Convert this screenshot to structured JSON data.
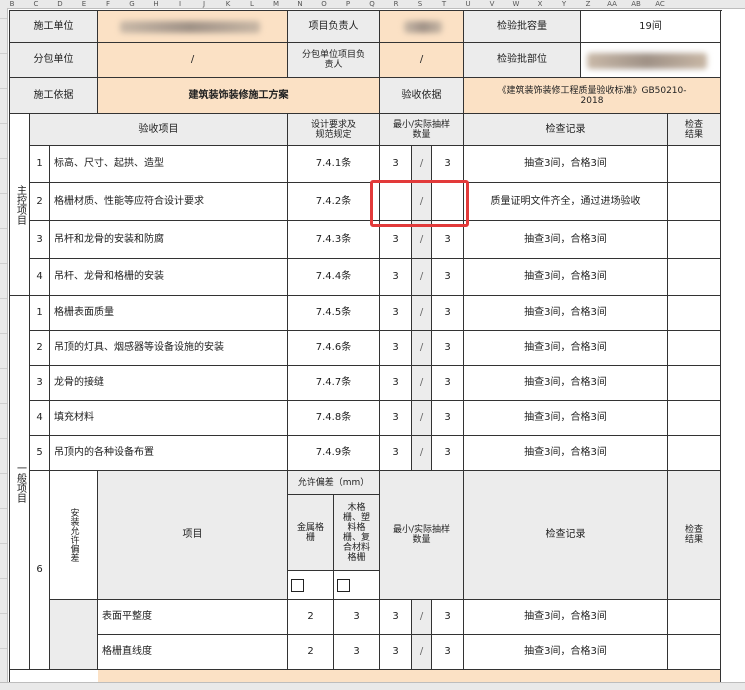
{
  "header": {
    "unit_label": "施工单位",
    "owner_label": "项目负责人",
    "capacity_label": "检验批容量",
    "capacity_value": "19间",
    "sub_unit_label": "分包单位",
    "sub_unit_value": "/",
    "sub_owner_label": "分包单位项目负责人",
    "sub_owner_value": "/",
    "part_label": "检验批部位",
    "basis_label": "施工依据",
    "basis_value": "建筑装饰装修施工方案",
    "accept_label": "验收依据",
    "accept_value": "《建筑装饰装修工程质量验收标准》GB50210-2018"
  },
  "table_header": {
    "item": "验收项目",
    "spec": "设计要求及规范规定",
    "sample": "最小/实际抽样数量",
    "record": "检查记录",
    "result": "检查结果"
  },
  "main_label": "主控项目",
  "general_label": "一般项目",
  "main_items": [
    {
      "no": "1",
      "name": "标高、尺寸、起拱、造型",
      "spec": "7.4.1条",
      "min": "3",
      "sep": "/",
      "act": "3",
      "record": "抽查3间，合格3间"
    },
    {
      "no": "2",
      "name": "格栅材质、性能等应符合设计要求",
      "spec": "7.4.2条",
      "min": "",
      "sep": "/",
      "act": "",
      "record": "质量证明文件齐全，通过进场验收"
    },
    {
      "no": "3",
      "name": "吊杆和龙骨的安装和防腐",
      "spec": "7.4.3条",
      "min": "3",
      "sep": "/",
      "act": "3",
      "record": "抽查3间，合格3间"
    },
    {
      "no": "4",
      "name": "吊杆、龙骨和格栅的安装",
      "spec": "7.4.4条",
      "min": "3",
      "sep": "/",
      "act": "3",
      "record": "抽查3间，合格3间"
    }
  ],
  "general_items": [
    {
      "no": "1",
      "name": "格栅表面质量",
      "spec": "7.4.5条",
      "min": "3",
      "sep": "/",
      "act": "3",
      "record": "抽查3间，合格3间"
    },
    {
      "no": "2",
      "name": "吊顶的灯具、烟感器等设备设施的安装",
      "spec": "7.4.6条",
      "min": "3",
      "sep": "/",
      "act": "3",
      "record": "抽查3间，合格3间"
    },
    {
      "no": "3",
      "name": "龙骨的接缝",
      "spec": "7.4.7条",
      "min": "3",
      "sep": "/",
      "act": "3",
      "record": "抽查3间，合格3间"
    },
    {
      "no": "4",
      "name": "填充材料",
      "spec": "7.4.8条",
      "min": "3",
      "sep": "/",
      "act": "3",
      "record": "抽查3间，合格3间"
    },
    {
      "no": "5",
      "name": "吊顶内的各种设备布置",
      "spec": "7.4.9条",
      "min": "3",
      "sep": "/",
      "act": "3",
      "record": "抽查3间，合格3间"
    }
  ],
  "tolerance": {
    "no": "6",
    "group_label": "安装允许偏差",
    "item_label": "项目",
    "allow_label": "允许偏差（mm）",
    "metal_label": "金属格栅",
    "wood_label": "木格栅、塑料格栅、复合材料格栅",
    "sample_label": "最小/实际抽样数量",
    "record_label": "检查记录",
    "result_label": "检查结果",
    "rows": [
      {
        "name": "表面平整度",
        "metal": "2",
        "wood": "3",
        "min": "3",
        "sep": "/",
        "act": "3",
        "record": "抽查3间，合格3间"
      },
      {
        "name": "格栅直线度",
        "metal": "2",
        "wood": "3",
        "min": "3",
        "sep": "/",
        "act": "3",
        "record": "抽查3间，合格3间"
      }
    ]
  },
  "col_letters": [
    "B",
    "C",
    "D",
    "E",
    "F",
    "G",
    "H",
    "I",
    "J",
    "K",
    "L",
    "M",
    "N",
    "O",
    "P",
    "Q",
    "R",
    "S",
    "T",
    "U",
    "V",
    "W",
    "X",
    "Y",
    "Z",
    "AA",
    "AB",
    "AC"
  ]
}
